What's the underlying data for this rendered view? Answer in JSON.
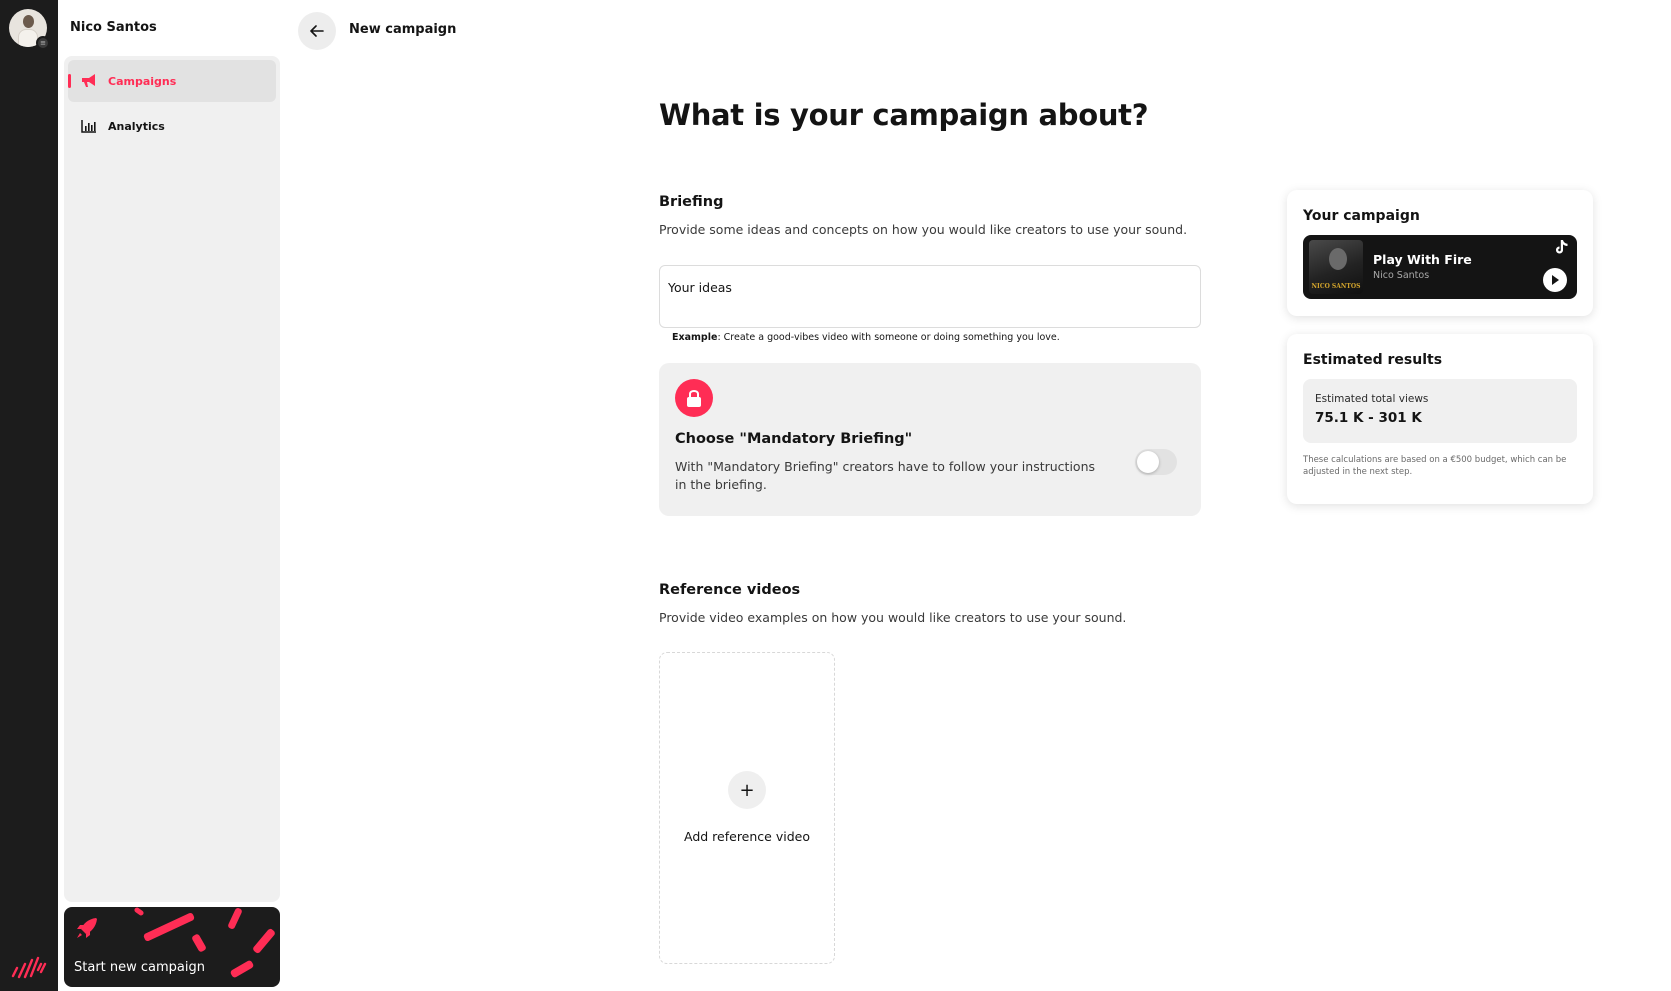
{
  "user": {
    "name": "Nico Santos"
  },
  "sidebar": {
    "items": [
      {
        "label": "Campaigns",
        "icon": "megaphone-icon",
        "active": true
      },
      {
        "label": "Analytics",
        "icon": "bar-chart-icon",
        "active": false
      }
    ],
    "start_campaign_label": "Start new campaign"
  },
  "header": {
    "title": "New campaign"
  },
  "main": {
    "title": "What is your campaign about?",
    "briefing": {
      "title": "Briefing",
      "description": "Provide some ideas and concepts on how you would like creators to use your sound.",
      "placeholder": "Your ideas",
      "example_label": "Example",
      "example_text": ": Create a good-vibes video with someone or doing something you love."
    },
    "mandatory": {
      "title": "Choose \"Mandatory Briefing\"",
      "description": "With \"Mandatory Briefing\" creators have to follow your instructions in the briefing.",
      "enabled": false
    },
    "reference": {
      "title": "Reference videos",
      "description": "Provide video examples on how you would like creators to use your sound.",
      "add_label": "Add reference video"
    }
  },
  "campaign_card": {
    "title": "Your campaign",
    "song_title": "Play With Fire",
    "artist": "Nico Santos",
    "cover_text": "NICO SANTOS"
  },
  "results_card": {
    "title": "Estimated results",
    "label": "Estimated total views",
    "value": "75.1 K - 301 K",
    "note": "These calculations are based on a €500 budget, which can be adjusted in the next step."
  },
  "colors": {
    "accent": "#ff2d55",
    "dark": "#1c1c1c",
    "panel": "#f0f0f0"
  }
}
